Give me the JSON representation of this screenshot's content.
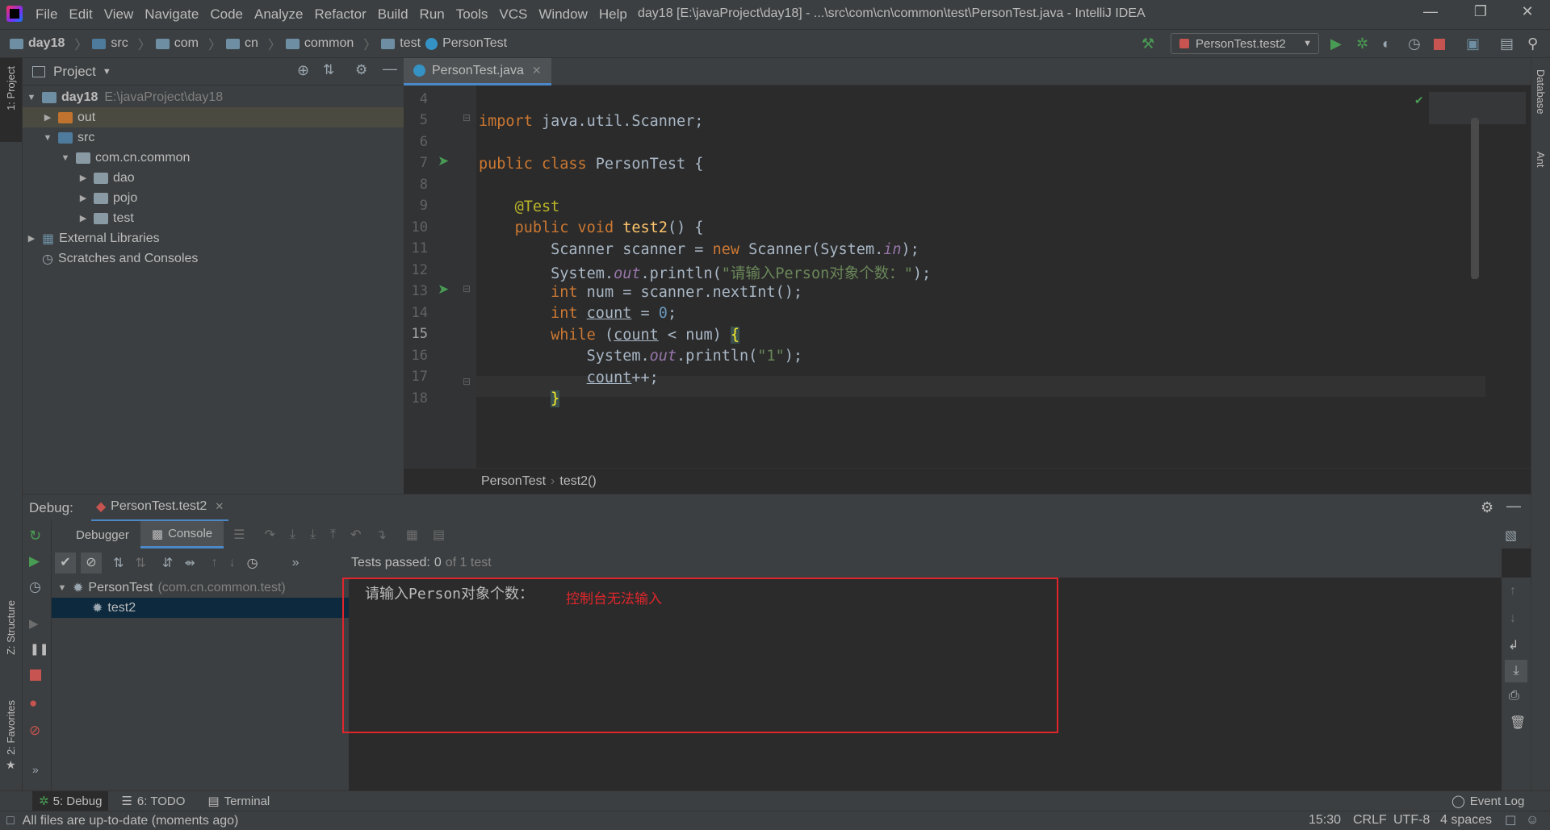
{
  "window": {
    "title": "day18 [E:\\javaProject\\day18] - ...\\src\\com\\cn\\common\\test\\PersonTest.java - IntelliJ IDEA",
    "menu": [
      "File",
      "Edit",
      "View",
      "Navigate",
      "Code",
      "Analyze",
      "Refactor",
      "Build",
      "Run",
      "Tools",
      "VCS",
      "Window",
      "Help"
    ]
  },
  "navbar": {
    "crumbs": [
      "day18",
      "src",
      "com",
      "cn",
      "common",
      "test",
      "PersonTest"
    ],
    "run_config": "PersonTest.test2"
  },
  "left_stripe": {
    "project_tab": "1: Project",
    "structure_tab": "Z: Structure",
    "favorites_tab": "2: Favorites"
  },
  "right_stripe": {
    "database_tab": "Database",
    "ant_tab": "Ant"
  },
  "project": {
    "title": "Project",
    "tree": [
      {
        "label": "day18",
        "path": "E:\\javaProject\\day18"
      },
      {
        "label": "out"
      },
      {
        "label": "src"
      },
      {
        "label": "com.cn.common"
      },
      {
        "label": "dao"
      },
      {
        "label": "pojo"
      },
      {
        "label": "test"
      },
      {
        "label": "External Libraries"
      },
      {
        "label": "Scratches and Consoles"
      }
    ]
  },
  "editor": {
    "tab": "PersonTest.java",
    "line_numbers": [
      "4",
      "5",
      "6",
      "7",
      "8",
      "9",
      "10",
      "11",
      "12",
      "13",
      "14",
      "15",
      "16",
      "17",
      "18"
    ],
    "breadcrumb": [
      "PersonTest",
      "test2()"
    ]
  },
  "debug": {
    "label": "Debug:",
    "session": "PersonTest.test2",
    "tabs": [
      "Debugger",
      "Console"
    ],
    "tests_status_prefix": "Tests passed:",
    "tests_status_count": "0",
    "tests_status_suffix": "of 1 test",
    "test_root": "PersonTest",
    "test_root_pkg": "(com.cn.common.test)",
    "test_child": "test2",
    "console_output": "请输入Person对象个数：",
    "annotation": "控制台无法输入"
  },
  "tool_tabs": [
    "5: Debug",
    "6: TODO",
    "Terminal"
  ],
  "event_log": "Event Log",
  "status": {
    "message": "All files are up-to-date (moments ago)",
    "position": "15:30",
    "line_sep": "CRLF",
    "encoding": "UTF-8",
    "indent": "4 spaces"
  },
  "colors": {
    "accent": "#4a88c7",
    "highlight_red": "#e0262c",
    "run_green": "#499c54"
  }
}
